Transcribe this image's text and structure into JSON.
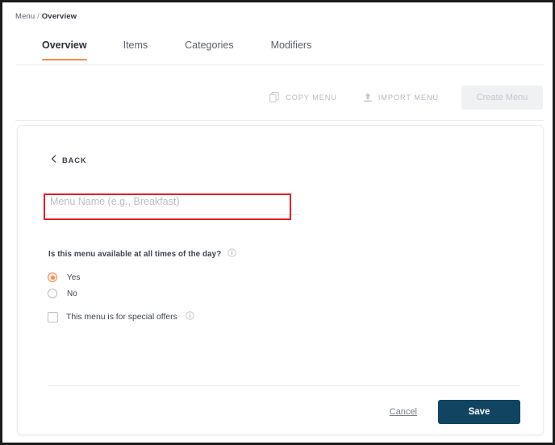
{
  "breadcrumb": {
    "root": "Menu",
    "separator": "/",
    "current": "Overview"
  },
  "tabs": [
    {
      "label": "Overview",
      "active": true
    },
    {
      "label": "Items",
      "active": false
    },
    {
      "label": "Categories",
      "active": false
    },
    {
      "label": "Modifiers",
      "active": false
    }
  ],
  "toolbar": {
    "copy_menu_label": "COPY MENU",
    "copy_menu_icon": "copy-icon",
    "import_menu_label": "IMPORT MENU",
    "import_menu_icon": "upload-icon",
    "create_menu_label": "Create Menu",
    "create_menu_disabled": true
  },
  "form": {
    "back_label": "BACK",
    "back_icon": "chevron-left-icon",
    "menu_name": {
      "value": "",
      "placeholder": "Menu Name (e.g., Breakfast)",
      "highlighted": true
    },
    "availability": {
      "question": "Is this menu available at all times of the day?",
      "info_icon": "info-icon",
      "options": [
        {
          "label": "Yes",
          "selected": true
        },
        {
          "label": "No",
          "selected": false
        }
      ]
    },
    "special_offers": {
      "label": "This menu is for special offers",
      "checked": false,
      "info_icon": "info-icon"
    }
  },
  "footer": {
    "cancel_label": "Cancel",
    "save_label": "Save"
  },
  "colors": {
    "accent_orange": "#f58a48",
    "primary_navy": "#114461",
    "highlight_red": "#ee1b24",
    "text_dark": "#3d4450",
    "text_muted": "#b6bac1"
  }
}
